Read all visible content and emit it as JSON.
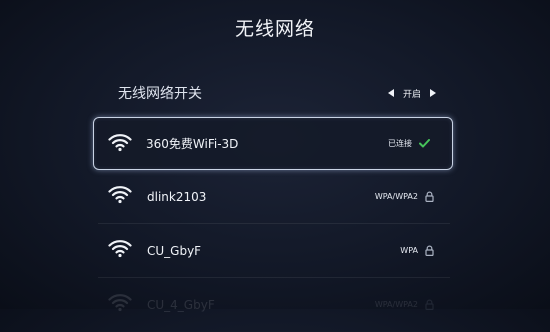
{
  "header": {
    "title": "无线网络"
  },
  "toggle": {
    "label": "无线网络开关",
    "value": "开启"
  },
  "networks": [
    {
      "ssid": "360免费WiFi-3D",
      "status": "已连接",
      "icon": "check-icon"
    },
    {
      "ssid": "dlink2103",
      "status": "WPA/WPA2",
      "icon": "lock-icon"
    },
    {
      "ssid": "CU_GbyF",
      "status": "WPA",
      "icon": "lock-icon"
    },
    {
      "ssid": "CU_4_GbyF",
      "status": "WPA/WPA2",
      "icon": "lock-icon"
    }
  ],
  "colors": {
    "accent_check": "#46c35a",
    "text": "#f0f3f8",
    "background": "#121827"
  }
}
